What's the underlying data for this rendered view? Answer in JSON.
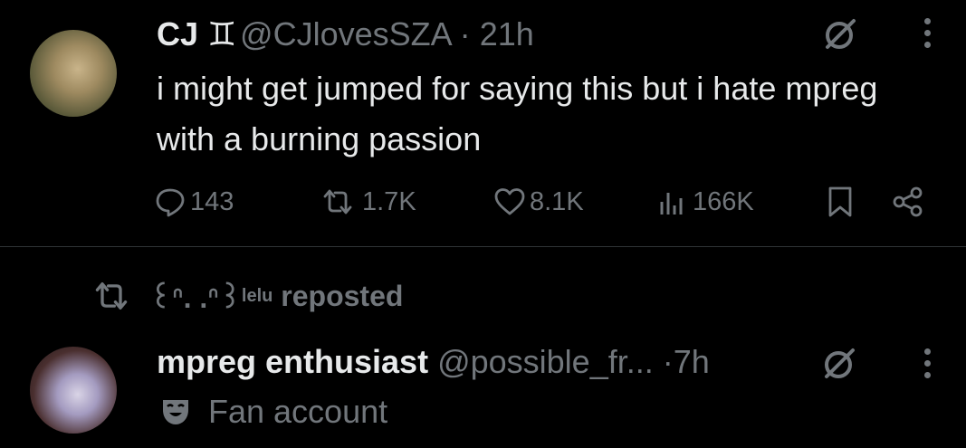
{
  "colors": {
    "background": "#000000",
    "text_primary": "#e7e9ea",
    "text_secondary": "#71767b",
    "divider": "#2f3336"
  },
  "tweets": [
    {
      "display_name": "CJ",
      "badge_icon": "gemini-symbol",
      "badge_glyph": "♊",
      "handle": "@CJlovesSZA",
      "separator": "·",
      "time": "21h",
      "text": "i might get jumped for saying this but i hate mpreg with a burning passion",
      "actions": {
        "reply": "143",
        "retweet": "1.7K",
        "like": "8.1K",
        "views": "166K"
      }
    },
    {
      "reposted_by": "꒰ᐢ. .ᐢ꒱",
      "reposted_by_sup": "lelu",
      "reposted_label": "reposted",
      "display_name": "mpreg enthusiast",
      "handle": "@possible_fr...",
      "separator": "·",
      "time": "7h",
      "bio_icon": "theater-mask",
      "bio": "Fan account"
    }
  ]
}
